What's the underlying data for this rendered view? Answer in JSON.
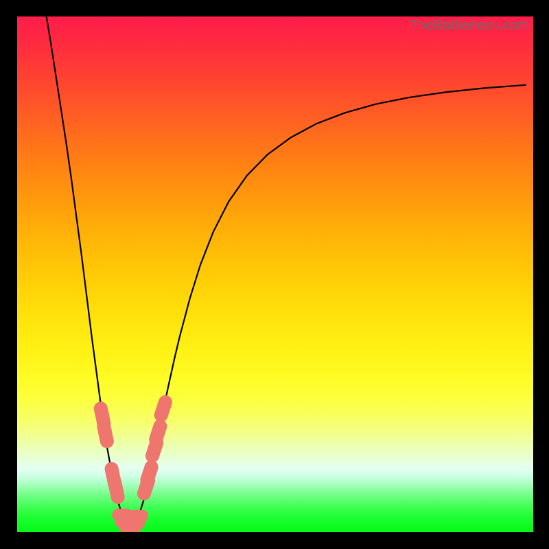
{
  "watermark": "TheBottleneck.com",
  "chart_data": {
    "type": "line",
    "title": "",
    "xlabel": "",
    "ylabel": "",
    "xlim": [
      0,
      100
    ],
    "ylim": [
      0,
      100
    ],
    "x": [
      5.5,
      6.5,
      7.5,
      8.5,
      9.5,
      10.5,
      11.5,
      12.5,
      13.5,
      14.5,
      15.5,
      16.5,
      17.5,
      18.5,
      19.5,
      20.5,
      21.5,
      22.5,
      23.5,
      24.5,
      25.5,
      26.5,
      27.5,
      28.5,
      29.5,
      30.5,
      31.5,
      33.5,
      35.5,
      38,
      41,
      44.5,
      48.5,
      53,
      58,
      63.5,
      69.5,
      76,
      83,
      90.5,
      98.5
    ],
    "values": [
      101,
      95,
      88.5,
      82,
      75.5,
      68.5,
      61,
      53.5,
      45.5,
      37.5,
      30,
      22.5,
      16,
      10.5,
      6,
      2.8,
      1.2,
      1.2,
      2.9,
      6.1,
      10.3,
      15,
      19.8,
      24.6,
      29.2,
      33.7,
      37.9,
      45.4,
      51.8,
      58.2,
      64.1,
      69.1,
      73.2,
      76.5,
      79.2,
      81.3,
      83,
      84.3,
      85.3,
      86.1,
      86.7
    ],
    "minimum_x": 22,
    "marker_clusters": {
      "left": [
        {
          "x": 16.5,
          "y": 22.5
        },
        {
          "x": 17.1,
          "y": 19.0
        },
        {
          "x": 18.6,
          "y": 10.8
        },
        {
          "x": 19.2,
          "y": 8.2
        }
      ],
      "bottom": [
        {
          "x": 20.4,
          "y": 3.3
        },
        {
          "x": 20.9,
          "y": 2.0
        },
        {
          "x": 21.6,
          "y": 1.1
        },
        {
          "x": 22.3,
          "y": 1.1
        },
        {
          "x": 22.9,
          "y": 1.9
        },
        {
          "x": 23.4,
          "y": 3.1
        }
      ],
      "right": [
        {
          "x": 25.0,
          "y": 8.7
        },
        {
          "x": 25.6,
          "y": 11.3
        },
        {
          "x": 26.6,
          "y": 16.0
        },
        {
          "x": 27.3,
          "y": 19.2
        },
        {
          "x": 28.3,
          "y": 23.9
        }
      ]
    },
    "background_gradient": {
      "top": "#ff1d4a",
      "middle": "#ffe40c",
      "bottom": "#04fa19"
    },
    "curve_color": "#000000",
    "marker_color": "#ee766f"
  }
}
